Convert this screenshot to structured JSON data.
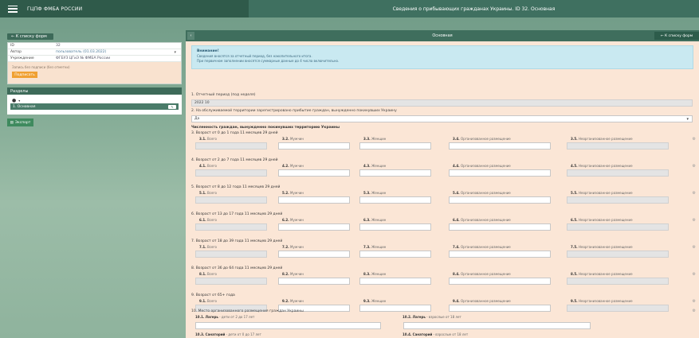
{
  "topbar": {
    "org": "ГЦПФ ФМБА РОССИИ",
    "title": "Сведения о прибывающих гражданах Украины. ID 32. Основная"
  },
  "left": {
    "back_label": "← К списку форм",
    "info": [
      {
        "key": "ID",
        "value": "32"
      },
      {
        "key": "Автор",
        "value": "пользователь (01.03.2022)"
      },
      {
        "key": "Учреждение",
        "value": "ФГБУЗ ЦГиЭ № ФМБА России"
      }
    ],
    "signature_text": "Запись без подписи (без отметки)",
    "sign_button": "Подписать",
    "sections_title": "Разделы",
    "section_item": "1. Основная",
    "export_button": "Экспорт"
  },
  "main": {
    "head": "Основная",
    "back_label": "← К списку форм",
    "notice": {
      "title": "Внимание!",
      "line1": "Сведения вносятся за отчетный период, без накопительного итога.",
      "line2": "При первичном заполнении вносятся суммарные данные до 4 числа включительно."
    },
    "period_label": "1. Отчетный период (под неделя)",
    "period_value": "2022 10",
    "q2_label": "2. На обслуживаемой территории зарегистрировано прибытие граждан, вынужденно покинувших Украину",
    "q2_value": "Да",
    "count_title": "Численность граждан, вынужденно покинувших территорию Украины",
    "groups": [
      {
        "title": "3. Возраст от 0 до 1 года 11 месяцев 29 дней",
        "n": "3"
      },
      {
        "title": "4. Возраст от 2 до 7 года 11 месяцев 29 дней",
        "n": "4"
      },
      {
        "title": "5. Возраст от 8 до 12 года 11 месяцев 29 дней",
        "n": "5"
      },
      {
        "title": "6. Возраст от 13 до 17 года 11 месяцев 29 дней",
        "n": "6"
      },
      {
        "title": "7. Возраст от 18 до 39 года 11 месяцев 29 дней",
        "n": "7"
      },
      {
        "title": "8. Возраст от 36 до 64 года 11 месяцев 29 дней",
        "n": "8"
      },
      {
        "title": "9. Возраст от 65+ года",
        "n": "9"
      }
    ],
    "cols": [
      "Всего",
      "Мужчин",
      "Женщин",
      "Организованное размещение",
      "Неорганизованное размещение"
    ],
    "q10_title": "10. Место организованного размещения граждан Украины",
    "q10": [
      {
        "num": "10.1.",
        "name": "Лагерь",
        "desc": " - дети от 2 до 17 лет"
      },
      {
        "num": "10.2.",
        "name": "Лагерь",
        "desc": " - взрослые от 18 лет"
      },
      {
        "num": "10.3.",
        "name": "Санаторий",
        "desc": " - дети от 0 до 17 лет"
      },
      {
        "num": "10.4.",
        "name": "Санаторий",
        "desc": " - взрослые от 18 лет"
      }
    ]
  }
}
